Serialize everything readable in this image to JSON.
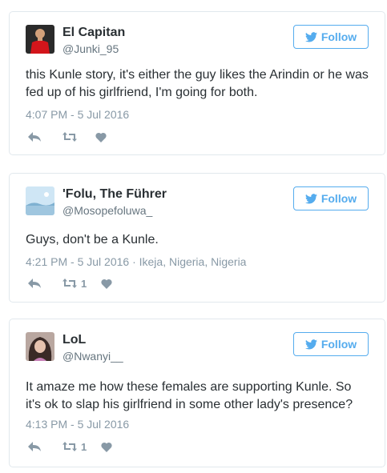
{
  "follow_label": "Follow",
  "colors": {
    "accent": "#55acee",
    "icon": "#8899a6",
    "text": "#292f33",
    "muted": "#66757f"
  },
  "tweets": [
    {
      "name": "El Capitan",
      "handle": "@Junki_95",
      "text": "this Kunle story, it's either the guy likes the Arindin or he was fed up of his girlfriend, I'm going for both.",
      "meta": "4:07 PM - 5 Jul 2016",
      "retweets": ""
    },
    {
      "name": "'Folu, The Führer",
      "handle": "@Mosopefoluwa_",
      "text": "Guys, don't be a Kunle.",
      "meta": "4:21 PM - 5 Jul 2016 · Ikeja, Nigeria, Nigeria",
      "retweets": "1"
    },
    {
      "name": "LoL",
      "handle": "@Nwanyi__",
      "text": "It amaze me how these females are supporting Kunle. So it's ok to slap his girlfriend in some other lady's presence?",
      "meta": "4:13 PM - 5 Jul 2016",
      "retweets": "1"
    }
  ]
}
